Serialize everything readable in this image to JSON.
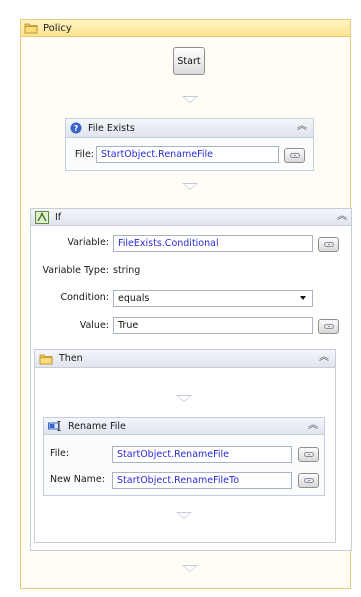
{
  "policy": {
    "title": "Policy"
  },
  "start": {
    "label": "Start"
  },
  "file_exists": {
    "title": "File Exists",
    "file_label": "File:",
    "file_value": "StartObject.RenameFile"
  },
  "if_block": {
    "title": "If",
    "variable_label": "Variable:",
    "variable_value": "FileExists.Conditional",
    "variable_type_label": "Variable Type:",
    "variable_type_value": "string",
    "condition_label": "Condition:",
    "condition_value": "equals",
    "value_label": "Value:",
    "value_value": "True"
  },
  "then_block": {
    "title": "Then"
  },
  "rename_file": {
    "title": "Rename File",
    "file_label": "File:",
    "file_value": "StartObject.RenameFile",
    "new_name_label": "New Name:",
    "new_name_value": "StartObject.RenameFileTo"
  },
  "icons": {
    "collapse": "double-chevron-up-icon",
    "bind": "chain-link-icon"
  },
  "colors": {
    "bound_text": "#2a2ad6",
    "policy_header": "#fbe38e",
    "card_header": "#dfe5ee"
  }
}
